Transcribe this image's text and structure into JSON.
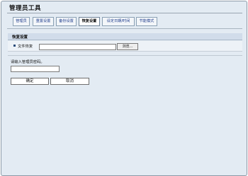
{
  "app": {
    "title": "管理员工具"
  },
  "tabs": [
    {
      "label": "管理员"
    },
    {
      "label": "重置设置"
    },
    {
      "label": "备份设置"
    },
    {
      "label": "恢复设置",
      "active": true
    },
    {
      "label": "设定日期/时间"
    },
    {
      "label": "节能模式"
    }
  ],
  "section": {
    "title": "恢复设置"
  },
  "file_row": {
    "label": "文件恢复",
    "value": "",
    "browse_label": "浏览..."
  },
  "password": {
    "label": "请输入管理员密码。",
    "value": ""
  },
  "buttons": {
    "ok_label": "确定",
    "cancel_label": "取消"
  }
}
